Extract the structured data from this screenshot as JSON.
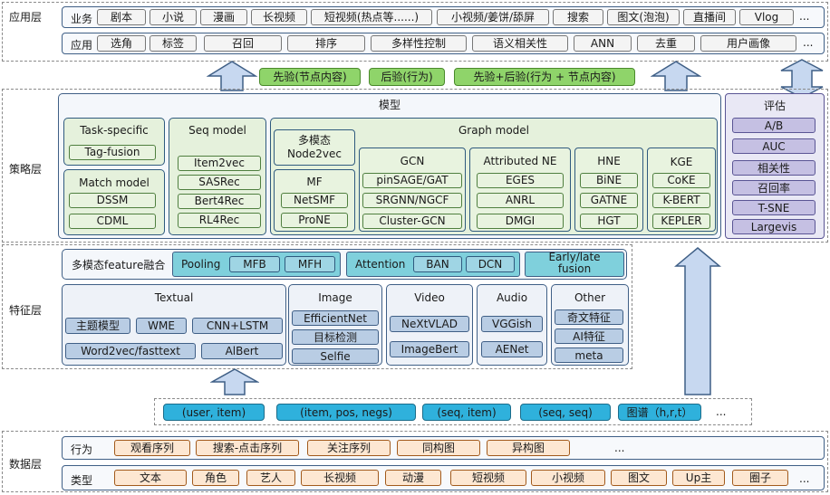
{
  "layers": {
    "app": "应用层",
    "strategy": "策略层",
    "feature": "特征层",
    "data": "数据层"
  },
  "app": {
    "biz_label": "业务",
    "biz_items": [
      "剧本",
      "小说",
      "漫画",
      "长视频",
      "短视频(热点等......)",
      "小视频/姜饼/舔屏",
      "搜索",
      "图文(泡泡)",
      "直播间",
      "Vlog",
      "..."
    ],
    "use_label": "应用",
    "use_items": [
      "选角",
      "标签",
      "召回",
      "排序",
      "多样性控制",
      "语义相关性",
      "ANN",
      "去重",
      "用户画像",
      "..."
    ]
  },
  "priors": [
    "先验(节点内容)",
    "后验(行为)",
    "先验+后验(行为 + 节点内容)"
  ],
  "model": {
    "title": "模型",
    "task_specific": {
      "title": "Task-specific",
      "items": [
        "Tag-fusion"
      ]
    },
    "match_model": {
      "title": "Match model",
      "items": [
        "DSSM",
        "CDML"
      ]
    },
    "seq_model": {
      "title": "Seq model",
      "items": [
        "Item2vec",
        "SASRec",
        "Bert4Rec",
        "RL4Rec"
      ]
    },
    "graph_model": {
      "title": "Graph model",
      "multimodal": "多模态\nNode2vec",
      "mf": {
        "title": "MF",
        "items": [
          "NetSMF",
          "ProNE"
        ]
      },
      "gcn": {
        "title": "GCN",
        "items": [
          "pinSAGE/GAT",
          "SRGNN/NGCF",
          "Cluster-GCN"
        ]
      },
      "attributed": {
        "title": "Attributed NE",
        "items": [
          "EGES",
          "ANRL",
          "DMGI"
        ]
      },
      "hne": {
        "title": "HNE",
        "items": [
          "BiNE",
          "GATNE",
          "HGT"
        ]
      },
      "kge": {
        "title": "KGE",
        "items": [
          "CoKE",
          "K-BERT",
          "KEPLER"
        ]
      }
    }
  },
  "eval": {
    "title": "评估",
    "items": [
      "A/B",
      "AUC",
      "相关性",
      "召回率",
      "T-SNE",
      "Largevis"
    ]
  },
  "fusion": {
    "label": "多模态feature融合",
    "pooling": {
      "label": "Pooling",
      "items": [
        "MFB",
        "MFH"
      ]
    },
    "attention": {
      "label": "Attention",
      "items": [
        "BAN",
        "DCN"
      ]
    },
    "early_late": "Early/late\nfusion"
  },
  "features": {
    "textual": {
      "title": "Textual",
      "items": [
        "主题模型",
        "WME",
        "CNN+LSTM",
        "Word2vec/fasttext",
        "AlBert"
      ]
    },
    "image": {
      "title": "Image",
      "items": [
        "EfficientNet",
        "目标检测",
        "Selfie"
      ]
    },
    "video": {
      "title": "Video",
      "items": [
        "NeXtVLAD",
        "ImageBert"
      ]
    },
    "audio": {
      "title": "Audio",
      "items": [
        "VGGish",
        "AENet"
      ]
    },
    "other": {
      "title": "Other",
      "items": [
        "奇文特征",
        "AI特征",
        "meta"
      ]
    }
  },
  "samples": [
    "(user, item)",
    "(item, pos, negs)",
    "(seq, item)",
    "(seq, seq)",
    "图谱（h,r,t）",
    "..."
  ],
  "data": {
    "behavior_label": "行为",
    "behavior_items": [
      "观看序列",
      "搜索-点击序列",
      "关注序列",
      "同构图",
      "异构图",
      "..."
    ],
    "type_label": "类型",
    "type_items": [
      "文本",
      "角色",
      "艺人",
      "长视频",
      "动漫",
      "短视频",
      "小视频",
      "图文",
      "Up主",
      "圈子",
      "..."
    ]
  },
  "colors": {
    "frame": "#3f5f86",
    "green": "#e5f1dc",
    "cyan": "#2fb1dc",
    "prior_green": "#8fd46a",
    "orange": "#fde7d2",
    "purple": "#c5c0e3",
    "arrow": "#c7d8f0"
  }
}
